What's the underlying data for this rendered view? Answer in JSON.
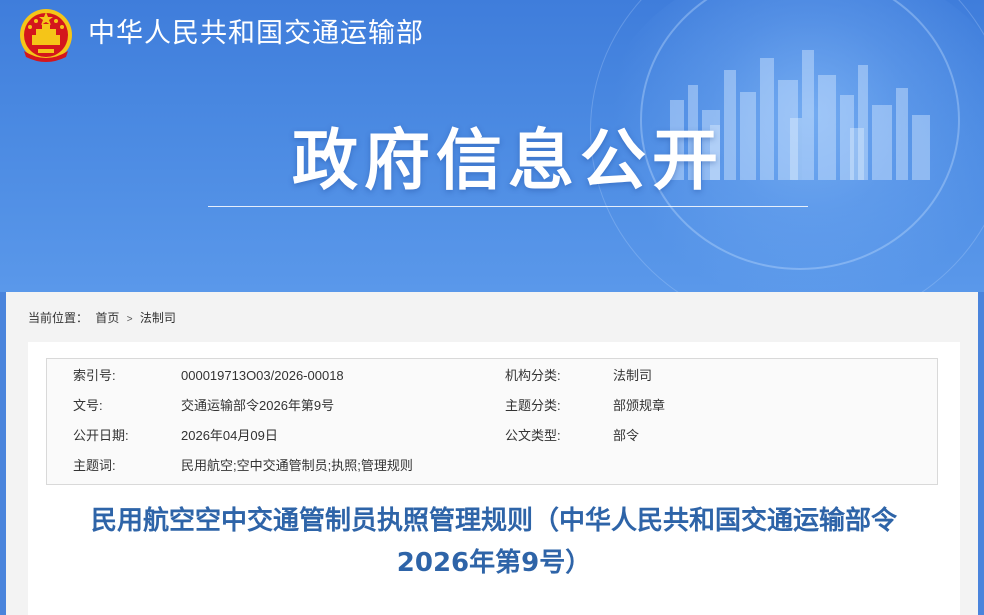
{
  "header": {
    "ministry_name": "中华人民共和国交通运输部",
    "banner_title": "政府信息公开"
  },
  "breadcrumb": {
    "prefix": "当前位置：",
    "home": "首页",
    "separator": ">",
    "current": "法制司"
  },
  "meta": {
    "index_no_label": "索引号:",
    "index_no": "000019713O03/2026-00018",
    "org_label": "机构分类:",
    "org": "法制司",
    "doc_no_label": "文号:",
    "doc_no": "交通运输部令2026年第9号",
    "topic_label": "主题分类:",
    "topic": "部颁规章",
    "date_label": "公开日期:",
    "date": "2026年04月09日",
    "type_label": "公文类型:",
    "type": "部令",
    "keywords_label": "主题词:",
    "keywords": "民用航空;空中交通管制员;执照;管理规则"
  },
  "document": {
    "title_line1": "民用航空空中交通管制员执照管理规则（中华人民共和国交通运输部令",
    "title_line2": "2026年第9号）"
  },
  "colors": {
    "banner_blue": "#4a84dc",
    "title_blue": "#2e64a8",
    "emblem_red": "#d4161c",
    "emblem_gold": "#f5c518"
  }
}
